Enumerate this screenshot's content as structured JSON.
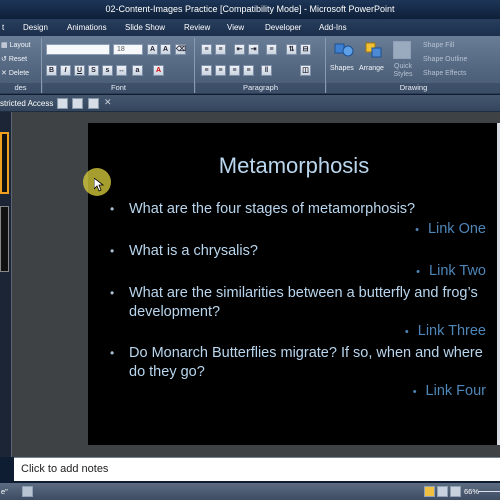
{
  "window": {
    "title": "02-Content-Images Practice [Compatibility Mode] - Microsoft PowerPoint"
  },
  "tabs": [
    "t",
    "Design",
    "Animations",
    "Slide Show",
    "Review",
    "View",
    "Developer",
    "Add-Ins"
  ],
  "ribbon": {
    "slides_group": {
      "layout_label": "Layout",
      "reset_label": "Reset",
      "delete_label": "Delete",
      "group_label": "des"
    },
    "font_group": {
      "size_value": "18",
      "group_label": "Font"
    },
    "paragraph_group": {
      "group_label": "Paragraph"
    },
    "drawing_group": {
      "shapes_label": "Shapes",
      "arrange_label": "Arrange",
      "quick_styles_label": "Quick Styles",
      "shape_fill_label": "Shape Fill",
      "shape_outline_label": "Shape Outline",
      "shape_effects_label": "Shape Effects",
      "group_label": "Drawing"
    }
  },
  "message_bar": {
    "text": "stricted Access"
  },
  "slide": {
    "title": "Metamorphosis",
    "items": [
      {
        "question": "What are the four stages of metamorphosis?",
        "link": "Link One"
      },
      {
        "question": "What is a chrysalis?",
        "link": "Link Two"
      },
      {
        "question": "What are the similarities between a butterfly and frog’s development?",
        "link": "Link Three"
      },
      {
        "question": "Do Monarch Butterflies migrate?  If so, when and where do they go?",
        "link": "Link Four"
      }
    ]
  },
  "notes": {
    "placeholder": "Click to add notes"
  },
  "status_bar": {
    "left_text": "e\"",
    "zoom": "66%"
  },
  "colors": {
    "slide_text": "#b9d6ee",
    "link": "#4e86b8",
    "ribbon": "#5a6e88"
  }
}
